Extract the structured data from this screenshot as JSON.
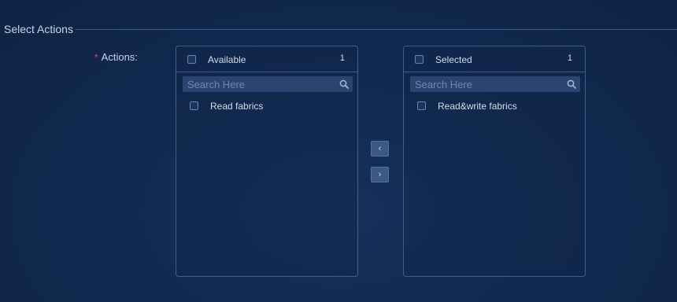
{
  "section": {
    "title": "Select Actions"
  },
  "field": {
    "required_mark": "*",
    "label": "Actions:"
  },
  "available": {
    "title": "Available",
    "count": "1",
    "search_placeholder": "Search Here",
    "items": [
      {
        "label": "Read fabrics"
      }
    ]
  },
  "selected": {
    "title": "Selected",
    "count": "1",
    "search_placeholder": "Search Here",
    "items": [
      {
        "label": "Read&write fabrics"
      }
    ]
  },
  "transfer": {
    "move_left_glyph": "‹",
    "move_right_glyph": "›"
  },
  "colors": {
    "background": "#112a50",
    "border": "#3e5f8c",
    "required": "#e0465a"
  },
  "icons": {
    "search": "search-icon",
    "move_left": "chevron-left-icon",
    "move_right": "chevron-right-icon"
  }
}
